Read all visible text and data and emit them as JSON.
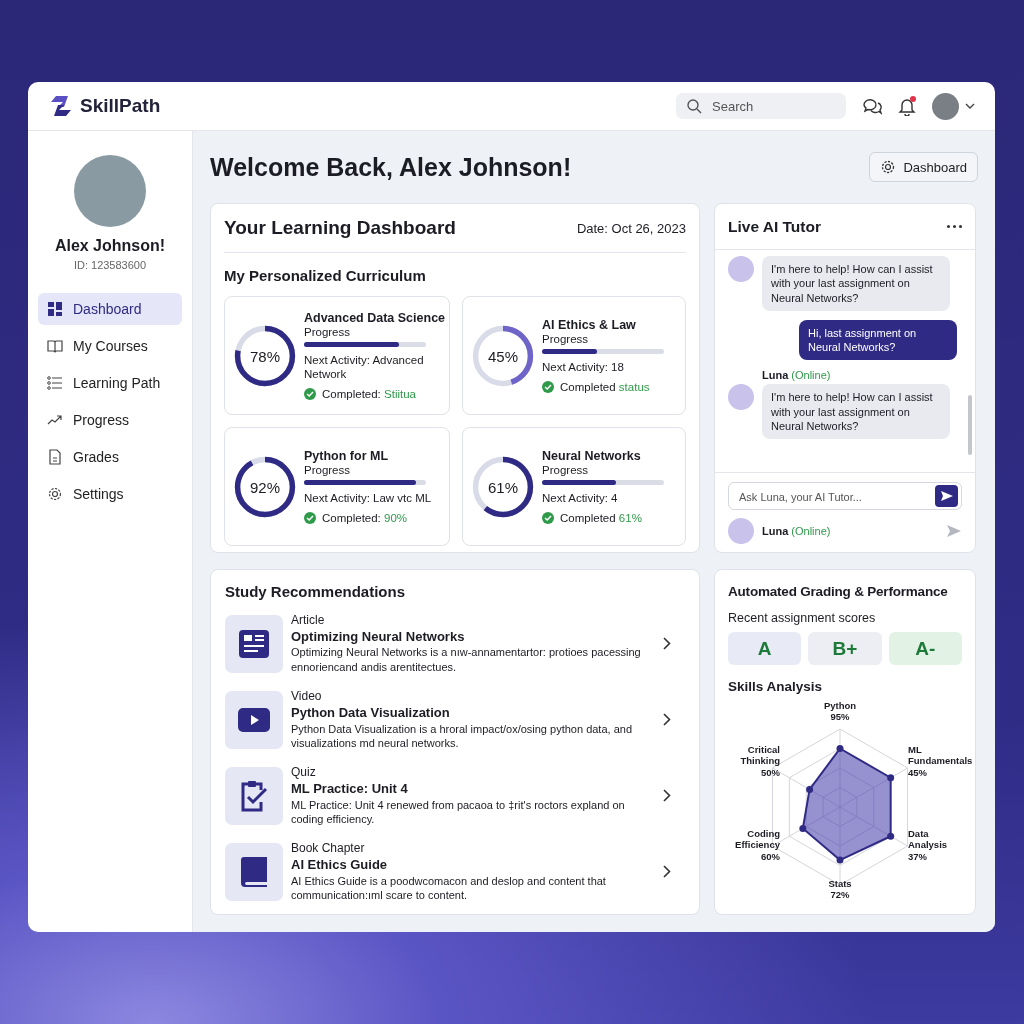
{
  "app": {
    "name": "SkillPath"
  },
  "header": {
    "search": {
      "placeholder": "Search"
    },
    "notification_dot": true
  },
  "profile": {
    "name": "Alex Johnson!",
    "id": "ID: 123583600"
  },
  "sidebar": {
    "items": [
      {
        "label": "Dashboard",
        "selected": true
      },
      {
        "label": "My Courses",
        "selected": false
      },
      {
        "label": "Learning Path",
        "selected": false
      },
      {
        "label": "Progress",
        "selected": false
      },
      {
        "label": "Grades",
        "selected": false
      },
      {
        "label": "Settings",
        "selected": false
      }
    ]
  },
  "page": {
    "title": "Welcome Back, Alex Johnson!",
    "action_button": "Dashboard"
  },
  "learning_dashboard": {
    "title": "Your Learning Dashboard",
    "date": "Date: Oct 26, 2023",
    "section_title": "My Personalized Curriculum",
    "courses": [
      {
        "title": "Advanced Data Science",
        "percent": "78%",
        "level": 0.78,
        "progress_label": "Progress",
        "next_activity": "Next Activity: Advanced Network",
        "completed_label": "Completed:",
        "completed_value": "Stiitua"
      },
      {
        "title": "AI Ethics & Law",
        "percent": "45%",
        "level": 0.45,
        "progress_label": "Progress",
        "next_activity": "Next Activity: 18",
        "completed_label": "Completed",
        "completed_value": "status"
      },
      {
        "title": "Python for ML",
        "percent": "92%",
        "level": 0.92,
        "progress_label": "Progress",
        "next_activity": "Next Activity: Law vtc ML",
        "completed_label": "Completed:",
        "completed_value": "90%"
      },
      {
        "title": "Neural Networks",
        "percent": "61%",
        "level": 0.61,
        "progress_label": "Progress",
        "next_activity": "Next Activity: 4",
        "completed_label": "Completed",
        "completed_value": "61%"
      }
    ]
  },
  "tutor": {
    "title": "Live AI Tutor",
    "messages": [
      {
        "kind": "bot",
        "text": "I'm here to help! How can I assist with your last assignment on Neural Networks?"
      },
      {
        "kind": "user",
        "text": "Hi, last assignment on Neural Networks?"
      },
      {
        "kind": "bot",
        "sender": "Luna",
        "status": "(Online)",
        "text": "I'm here to help! How can I assist with your last assignment on Neural Networks?"
      }
    ],
    "input": {
      "placeholder": "Ask Luna, your AI Tutor..."
    },
    "footer": {
      "name": "Luna",
      "status": "(Online)"
    }
  },
  "recommendations": {
    "title": "Study Recommendations",
    "items": [
      {
        "kind": "article",
        "type_label": "Article",
        "title": "Optimizing Neural Networks",
        "description": "Optimizing Neural Networks is a nıw-annamentartor: protioes pacessing ennoriencand andis arentitectues."
      },
      {
        "kind": "video",
        "type_label": "Video",
        "title": "Python Data Visualization",
        "description": "Python Data Visualization is a hroral impact/ox/osing python data, and visualizations md neural networks."
      },
      {
        "kind": "quiz",
        "type_label": "Quiz",
        "title": "ML Practice: Unit 4",
        "description": "ML Practice: Unit 4 renewed from pacaoa to ‡rit's roctors expland on coding efficiency."
      },
      {
        "kind": "book",
        "type_label": "Book Chapter",
        "title": "AI Ethics Guide",
        "description": "AI Ethics Guide is a poodwcomacon and deslop and content that communication:ıml scare to content."
      }
    ]
  },
  "grading": {
    "title": "Automated Grading & Performance",
    "scores_label": "Recent assignment scores",
    "scores": [
      {
        "grade": "A",
        "color": "#e8eaf6"
      },
      {
        "grade": "B+",
        "color": "#eceef3"
      },
      {
        "grade": "A-",
        "color": "#e2f3e6"
      }
    ],
    "skills_title": "Skills Analysis",
    "skills": [
      {
        "name": "Python",
        "value": "95%"
      },
      {
        "name": "Critical Thinking",
        "value": "50%"
      },
      {
        "name": "ML Fundamentals",
        "value": "45%"
      },
      {
        "name": "Coding Efficiency",
        "value": "60%"
      },
      {
        "name": "Data Analysis",
        "value": "37%"
      },
      {
        "name": "Stats",
        "value": "72%"
      }
    ]
  }
}
